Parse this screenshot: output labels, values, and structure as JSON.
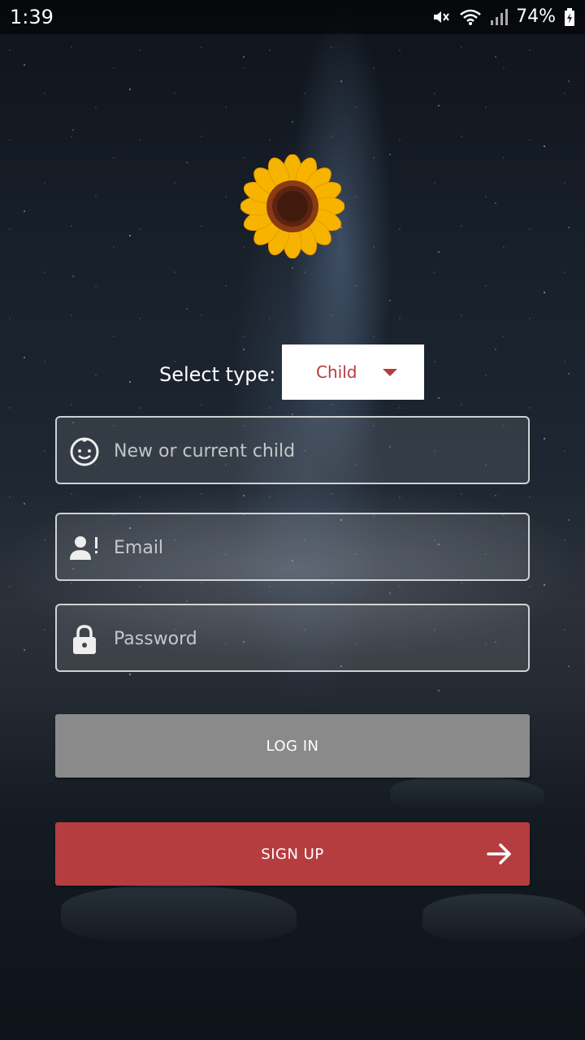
{
  "status_bar": {
    "time": "1:39",
    "battery": "74%",
    "icons": [
      "mute-icon",
      "wifi-icon",
      "signal-icon",
      "battery-icon"
    ]
  },
  "logo": {
    "icon": "sunflower-icon"
  },
  "select_type": {
    "label": "Select type:",
    "value": "Child",
    "accent_color": "#b43c3f"
  },
  "fields": {
    "child": {
      "placeholder": "New or current child",
      "value": "",
      "icon": "baby-face-icon"
    },
    "email": {
      "placeholder": "Email",
      "value": "",
      "icon": "user-alert-icon"
    },
    "password": {
      "placeholder": "Password",
      "value": "",
      "icon": "lock-icon"
    }
  },
  "buttons": {
    "login": {
      "label": "LOG IN",
      "color": "#8a8a8a"
    },
    "signup": {
      "label": "SIGN UP",
      "color": "#b53d40",
      "icon": "arrow-right-icon"
    }
  }
}
